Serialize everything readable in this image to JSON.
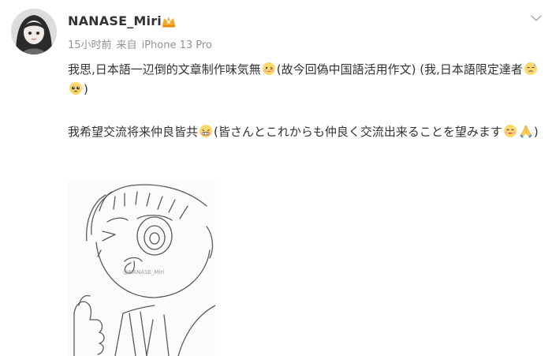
{
  "post": {
    "username": "NANASE_Miri",
    "time": "15小时前",
    "source_prefix": "来自",
    "source_device": "iPhone 13 Pro",
    "paragraph1": {
      "text_a": "我思,日本語一辺倒的文章制作味気無",
      "text_b": "(故今回偽中国語活用作文) (我,日本語限定達者",
      "text_c": ")"
    },
    "paragraph2": {
      "text_a": "我希望交流将来仲良皆共",
      "text_b": "(皆さんとこれからも仲良く交流出来ることを望みます",
      "text_c": ")"
    },
    "image_watermark": "@NANASE_Miri",
    "icons": {
      "vip_badge": "crown-badge-icon",
      "more": "chevron-down-icon",
      "emoji_1": "cute-pout-emoji-icon",
      "emoji_2": "sweat-emoji-icon",
      "emoji_3": "pleading-emoji-icon",
      "emoji_4": "grimace-emoji-icon",
      "emoji_5": "smile-emoji-icon",
      "emoji_6": "pray-hands-emoji-icon"
    },
    "colors": {
      "text": "#333333",
      "meta": "#939393",
      "badge": "#f5a623",
      "emoji_yellow": "#ffcc33"
    }
  }
}
